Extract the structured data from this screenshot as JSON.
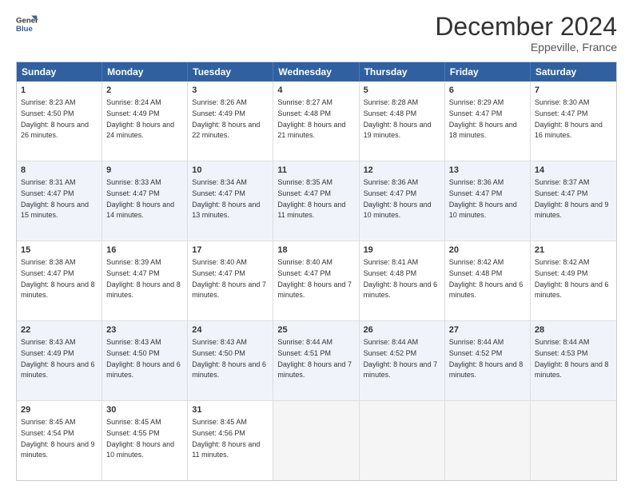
{
  "logo": {
    "line1": "General",
    "line2": "Blue"
  },
  "title": "December 2024",
  "subtitle": "Eppeville, France",
  "days": [
    "Sunday",
    "Monday",
    "Tuesday",
    "Wednesday",
    "Thursday",
    "Friday",
    "Saturday"
  ],
  "rows": [
    [
      {
        "day": "1",
        "sunrise": "8:23 AM",
        "sunset": "4:50 PM",
        "daylight": "8 hours and 26 minutes."
      },
      {
        "day": "2",
        "sunrise": "8:24 AM",
        "sunset": "4:49 PM",
        "daylight": "8 hours and 24 minutes."
      },
      {
        "day": "3",
        "sunrise": "8:26 AM",
        "sunset": "4:49 PM",
        "daylight": "8 hours and 22 minutes."
      },
      {
        "day": "4",
        "sunrise": "8:27 AM",
        "sunset": "4:48 PM",
        "daylight": "8 hours and 21 minutes."
      },
      {
        "day": "5",
        "sunrise": "8:28 AM",
        "sunset": "4:48 PM",
        "daylight": "8 hours and 19 minutes."
      },
      {
        "day": "6",
        "sunrise": "8:29 AM",
        "sunset": "4:47 PM",
        "daylight": "8 hours and 18 minutes."
      },
      {
        "day": "7",
        "sunrise": "8:30 AM",
        "sunset": "4:47 PM",
        "daylight": "8 hours and 16 minutes."
      }
    ],
    [
      {
        "day": "8",
        "sunrise": "8:31 AM",
        "sunset": "4:47 PM",
        "daylight": "8 hours and 15 minutes."
      },
      {
        "day": "9",
        "sunrise": "8:33 AM",
        "sunset": "4:47 PM",
        "daylight": "8 hours and 14 minutes."
      },
      {
        "day": "10",
        "sunrise": "8:34 AM",
        "sunset": "4:47 PM",
        "daylight": "8 hours and 13 minutes."
      },
      {
        "day": "11",
        "sunrise": "8:35 AM",
        "sunset": "4:47 PM",
        "daylight": "8 hours and 11 minutes."
      },
      {
        "day": "12",
        "sunrise": "8:36 AM",
        "sunset": "4:47 PM",
        "daylight": "8 hours and 10 minutes."
      },
      {
        "day": "13",
        "sunrise": "8:36 AM",
        "sunset": "4:47 PM",
        "daylight": "8 hours and 10 minutes."
      },
      {
        "day": "14",
        "sunrise": "8:37 AM",
        "sunset": "4:47 PM",
        "daylight": "8 hours and 9 minutes."
      }
    ],
    [
      {
        "day": "15",
        "sunrise": "8:38 AM",
        "sunset": "4:47 PM",
        "daylight": "8 hours and 8 minutes."
      },
      {
        "day": "16",
        "sunrise": "8:39 AM",
        "sunset": "4:47 PM",
        "daylight": "8 hours and 8 minutes."
      },
      {
        "day": "17",
        "sunrise": "8:40 AM",
        "sunset": "4:47 PM",
        "daylight": "8 hours and 7 minutes."
      },
      {
        "day": "18",
        "sunrise": "8:40 AM",
        "sunset": "4:47 PM",
        "daylight": "8 hours and 7 minutes."
      },
      {
        "day": "19",
        "sunrise": "8:41 AM",
        "sunset": "4:48 PM",
        "daylight": "8 hours and 6 minutes."
      },
      {
        "day": "20",
        "sunrise": "8:42 AM",
        "sunset": "4:48 PM",
        "daylight": "8 hours and 6 minutes."
      },
      {
        "day": "21",
        "sunrise": "8:42 AM",
        "sunset": "4:49 PM",
        "daylight": "8 hours and 6 minutes."
      }
    ],
    [
      {
        "day": "22",
        "sunrise": "8:43 AM",
        "sunset": "4:49 PM",
        "daylight": "8 hours and 6 minutes."
      },
      {
        "day": "23",
        "sunrise": "8:43 AM",
        "sunset": "4:50 PM",
        "daylight": "8 hours and 6 minutes."
      },
      {
        "day": "24",
        "sunrise": "8:43 AM",
        "sunset": "4:50 PM",
        "daylight": "8 hours and 6 minutes."
      },
      {
        "day": "25",
        "sunrise": "8:44 AM",
        "sunset": "4:51 PM",
        "daylight": "8 hours and 7 minutes."
      },
      {
        "day": "26",
        "sunrise": "8:44 AM",
        "sunset": "4:52 PM",
        "daylight": "8 hours and 7 minutes."
      },
      {
        "day": "27",
        "sunrise": "8:44 AM",
        "sunset": "4:52 PM",
        "daylight": "8 hours and 8 minutes."
      },
      {
        "day": "28",
        "sunrise": "8:44 AM",
        "sunset": "4:53 PM",
        "daylight": "8 hours and 8 minutes."
      }
    ],
    [
      {
        "day": "29",
        "sunrise": "8:45 AM",
        "sunset": "4:54 PM",
        "daylight": "8 hours and 9 minutes."
      },
      {
        "day": "30",
        "sunrise": "8:45 AM",
        "sunset": "4:55 PM",
        "daylight": "8 hours and 10 minutes."
      },
      {
        "day": "31",
        "sunrise": "8:45 AM",
        "sunset": "4:56 PM",
        "daylight": "8 hours and 11 minutes."
      },
      null,
      null,
      null,
      null
    ]
  ]
}
